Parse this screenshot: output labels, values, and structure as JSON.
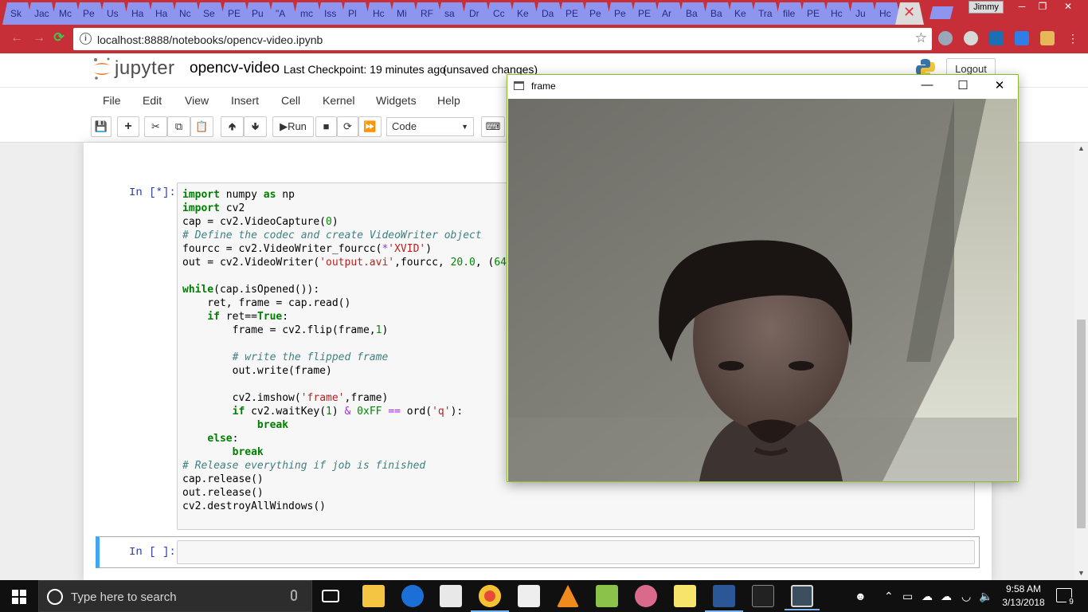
{
  "browser": {
    "tabs": [
      {
        "label": "Sk"
      },
      {
        "label": "Jac"
      },
      {
        "label": "Mc"
      },
      {
        "label": "Pe"
      },
      {
        "label": "Us"
      },
      {
        "label": "Ha"
      },
      {
        "label": "Ha"
      },
      {
        "label": "Nc"
      },
      {
        "label": "Se"
      },
      {
        "label": "PE"
      },
      {
        "label": "Pu"
      },
      {
        "label": "\"A"
      },
      {
        "label": "mc"
      },
      {
        "label": "Iss"
      },
      {
        "label": "Pl"
      },
      {
        "label": "Hc"
      },
      {
        "label": "Mi"
      },
      {
        "label": "RF"
      },
      {
        "label": "sa"
      },
      {
        "label": "Dr"
      },
      {
        "label": "Cc"
      },
      {
        "label": "Ke"
      },
      {
        "label": "Da"
      },
      {
        "label": "PE"
      },
      {
        "label": "Pe"
      },
      {
        "label": "Pe"
      },
      {
        "label": "PE"
      },
      {
        "label": "Ar"
      },
      {
        "label": "Ba"
      },
      {
        "label": "Ba"
      },
      {
        "label": "Ke"
      },
      {
        "label": "Tra"
      },
      {
        "label": "file"
      },
      {
        "label": "PE"
      },
      {
        "label": "Hc"
      },
      {
        "label": "Ju"
      },
      {
        "label": "Hc"
      }
    ],
    "active_tab_close": "✕",
    "profile_name": "Jimmy",
    "url": "localhost:8888/notebooks/opencv-video.ipynb"
  },
  "jupyter": {
    "brand": "jupyter",
    "notebook_name": "opencv-video",
    "checkpoint": "Last Checkpoint: 19 minutes ago",
    "unsaved": "(unsaved changes)",
    "logout_label": "Logout",
    "menu": [
      "File",
      "Edit",
      "View",
      "Insert",
      "Cell",
      "Kernel",
      "Widgets",
      "Help"
    ],
    "toolbar": {
      "run_label": "Run",
      "cell_type": "Code"
    },
    "cells": [
      {
        "prompt": "In [*]:"
      },
      {
        "prompt": "In [ ]:"
      }
    ]
  },
  "frame_window": {
    "title": "frame"
  },
  "taskbar": {
    "search_placeholder": "Type here to search",
    "time": "9:58 AM",
    "date": "3/13/2018",
    "notifications": "9"
  },
  "colors": {
    "chrome_frame": "#c62f37",
    "tab_inactive": "#8e95ee",
    "jupyter_prompt": "#303f9f",
    "selected_cell_border": "#42a5f5",
    "frame_border": "#8cbd2f",
    "taskbar": "#101010"
  }
}
